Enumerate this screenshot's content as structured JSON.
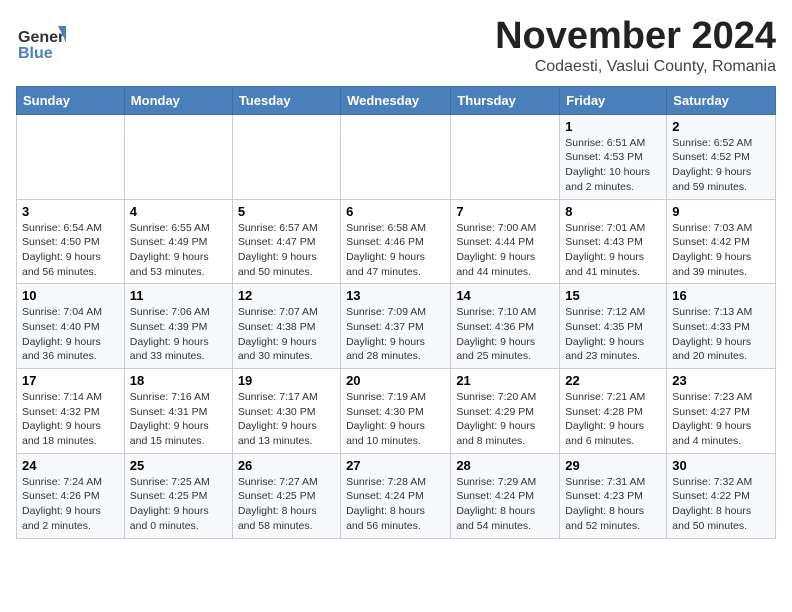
{
  "header": {
    "logo_general": "General",
    "logo_blue": "Blue",
    "month": "November 2024",
    "location": "Codaesti, Vaslui County, Romania"
  },
  "weekdays": [
    "Sunday",
    "Monday",
    "Tuesday",
    "Wednesday",
    "Thursday",
    "Friday",
    "Saturday"
  ],
  "weeks": [
    [
      {
        "day": "",
        "detail": ""
      },
      {
        "day": "",
        "detail": ""
      },
      {
        "day": "",
        "detail": ""
      },
      {
        "day": "",
        "detail": ""
      },
      {
        "day": "",
        "detail": ""
      },
      {
        "day": "1",
        "detail": "Sunrise: 6:51 AM\nSunset: 4:53 PM\nDaylight: 10 hours\nand 2 minutes."
      },
      {
        "day": "2",
        "detail": "Sunrise: 6:52 AM\nSunset: 4:52 PM\nDaylight: 9 hours\nand 59 minutes."
      }
    ],
    [
      {
        "day": "3",
        "detail": "Sunrise: 6:54 AM\nSunset: 4:50 PM\nDaylight: 9 hours\nand 56 minutes."
      },
      {
        "day": "4",
        "detail": "Sunrise: 6:55 AM\nSunset: 4:49 PM\nDaylight: 9 hours\nand 53 minutes."
      },
      {
        "day": "5",
        "detail": "Sunrise: 6:57 AM\nSunset: 4:47 PM\nDaylight: 9 hours\nand 50 minutes."
      },
      {
        "day": "6",
        "detail": "Sunrise: 6:58 AM\nSunset: 4:46 PM\nDaylight: 9 hours\nand 47 minutes."
      },
      {
        "day": "7",
        "detail": "Sunrise: 7:00 AM\nSunset: 4:44 PM\nDaylight: 9 hours\nand 44 minutes."
      },
      {
        "day": "8",
        "detail": "Sunrise: 7:01 AM\nSunset: 4:43 PM\nDaylight: 9 hours\nand 41 minutes."
      },
      {
        "day": "9",
        "detail": "Sunrise: 7:03 AM\nSunset: 4:42 PM\nDaylight: 9 hours\nand 39 minutes."
      }
    ],
    [
      {
        "day": "10",
        "detail": "Sunrise: 7:04 AM\nSunset: 4:40 PM\nDaylight: 9 hours\nand 36 minutes."
      },
      {
        "day": "11",
        "detail": "Sunrise: 7:06 AM\nSunset: 4:39 PM\nDaylight: 9 hours\nand 33 minutes."
      },
      {
        "day": "12",
        "detail": "Sunrise: 7:07 AM\nSunset: 4:38 PM\nDaylight: 9 hours\nand 30 minutes."
      },
      {
        "day": "13",
        "detail": "Sunrise: 7:09 AM\nSunset: 4:37 PM\nDaylight: 9 hours\nand 28 minutes."
      },
      {
        "day": "14",
        "detail": "Sunrise: 7:10 AM\nSunset: 4:36 PM\nDaylight: 9 hours\nand 25 minutes."
      },
      {
        "day": "15",
        "detail": "Sunrise: 7:12 AM\nSunset: 4:35 PM\nDaylight: 9 hours\nand 23 minutes."
      },
      {
        "day": "16",
        "detail": "Sunrise: 7:13 AM\nSunset: 4:33 PM\nDaylight: 9 hours\nand 20 minutes."
      }
    ],
    [
      {
        "day": "17",
        "detail": "Sunrise: 7:14 AM\nSunset: 4:32 PM\nDaylight: 9 hours\nand 18 minutes."
      },
      {
        "day": "18",
        "detail": "Sunrise: 7:16 AM\nSunset: 4:31 PM\nDaylight: 9 hours\nand 15 minutes."
      },
      {
        "day": "19",
        "detail": "Sunrise: 7:17 AM\nSunset: 4:30 PM\nDaylight: 9 hours\nand 13 minutes."
      },
      {
        "day": "20",
        "detail": "Sunrise: 7:19 AM\nSunset: 4:30 PM\nDaylight: 9 hours\nand 10 minutes."
      },
      {
        "day": "21",
        "detail": "Sunrise: 7:20 AM\nSunset: 4:29 PM\nDaylight: 9 hours\nand 8 minutes."
      },
      {
        "day": "22",
        "detail": "Sunrise: 7:21 AM\nSunset: 4:28 PM\nDaylight: 9 hours\nand 6 minutes."
      },
      {
        "day": "23",
        "detail": "Sunrise: 7:23 AM\nSunset: 4:27 PM\nDaylight: 9 hours\nand 4 minutes."
      }
    ],
    [
      {
        "day": "24",
        "detail": "Sunrise: 7:24 AM\nSunset: 4:26 PM\nDaylight: 9 hours\nand 2 minutes."
      },
      {
        "day": "25",
        "detail": "Sunrise: 7:25 AM\nSunset: 4:25 PM\nDaylight: 9 hours\nand 0 minutes."
      },
      {
        "day": "26",
        "detail": "Sunrise: 7:27 AM\nSunset: 4:25 PM\nDaylight: 8 hours\nand 58 minutes."
      },
      {
        "day": "27",
        "detail": "Sunrise: 7:28 AM\nSunset: 4:24 PM\nDaylight: 8 hours\nand 56 minutes."
      },
      {
        "day": "28",
        "detail": "Sunrise: 7:29 AM\nSunset: 4:24 PM\nDaylight: 8 hours\nand 54 minutes."
      },
      {
        "day": "29",
        "detail": "Sunrise: 7:31 AM\nSunset: 4:23 PM\nDaylight: 8 hours\nand 52 minutes."
      },
      {
        "day": "30",
        "detail": "Sunrise: 7:32 AM\nSunset: 4:22 PM\nDaylight: 8 hours\nand 50 minutes."
      }
    ]
  ]
}
